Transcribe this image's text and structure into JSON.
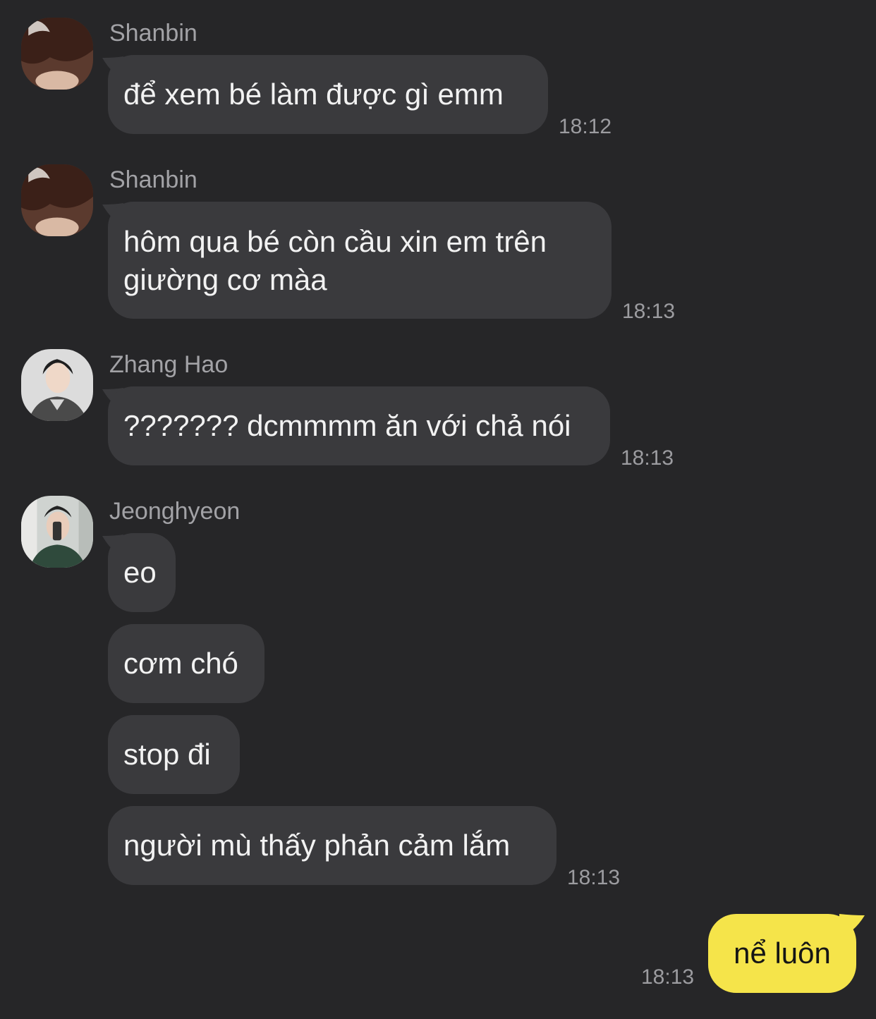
{
  "messages": [
    {
      "sender": "Shanbin",
      "avatar": "avatar-shanbin",
      "bubbles": [
        "để xem bé làm được gì emm"
      ],
      "time": "18:12"
    },
    {
      "sender": "Shanbin",
      "avatar": "avatar-shanbin",
      "bubbles": [
        "hôm qua bé còn cầu xin em trên giường cơ màa"
      ],
      "time": "18:13"
    },
    {
      "sender": "Zhang Hao",
      "avatar": "avatar-zhanghao",
      "bubbles": [
        "??????? dcmmmm ăn với chả nói"
      ],
      "time": "18:13"
    },
    {
      "sender": "Jeonghyeon",
      "avatar": "avatar-jeonghyeon",
      "bubbles": [
        "eo",
        "cơm chó",
        "stop đi",
        "người mù thấy phản cảm lắm"
      ],
      "time": "18:13"
    }
  ],
  "me": {
    "text": "nể luôn",
    "time": "18:13"
  },
  "colors": {
    "background": "#262628",
    "bubble": "#3a3a3d",
    "my_bubble": "#f5e44a",
    "meta_text": "#9c9ca0"
  }
}
